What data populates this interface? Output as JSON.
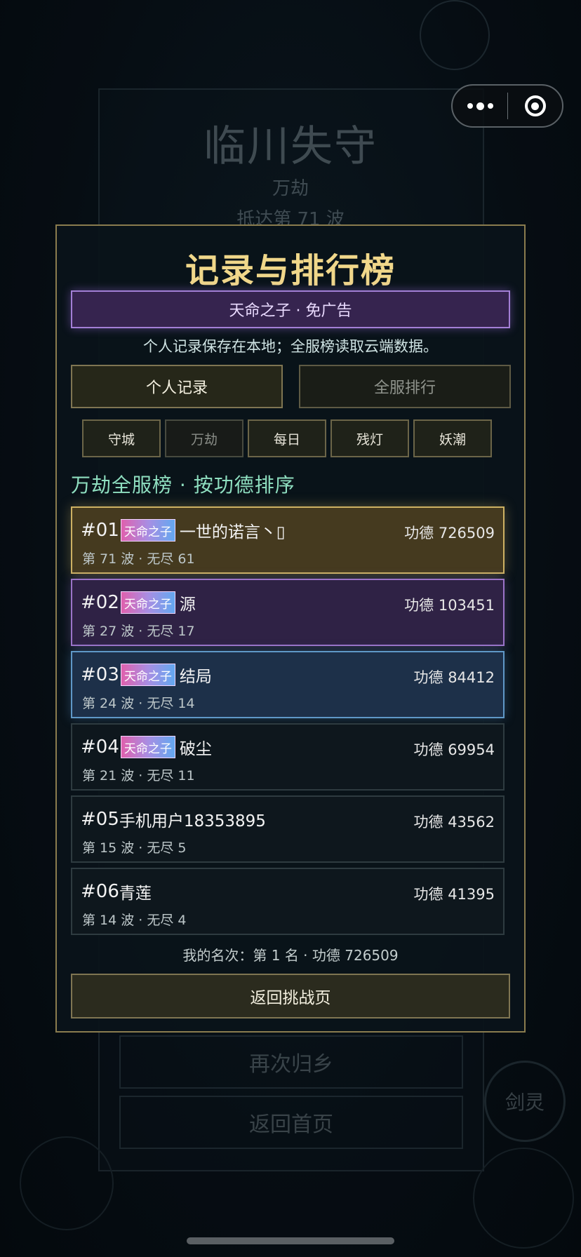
{
  "background_screen": {
    "title": "临川失守",
    "mode": "万劫",
    "wave": "抵达第 71 波",
    "buttons": [
      "再次归乡",
      "返回首页"
    ],
    "side_button": "剑灵"
  },
  "modal": {
    "title": "记录与排行榜",
    "vip_banner": "天命之子 · 免广告",
    "hint": "个人记录保存在本地；全服榜读取云端数据。",
    "main_tabs": [
      {
        "label": "个人记录",
        "active": true
      },
      {
        "label": "全服排行",
        "active": false
      }
    ],
    "mode_tabs": [
      {
        "label": "守城",
        "active": true
      },
      {
        "label": "万劫",
        "active": false
      },
      {
        "label": "每日",
        "active": true
      },
      {
        "label": "残灯",
        "active": true
      },
      {
        "label": "妖潮",
        "active": true
      }
    ],
    "section_title": "万劫全服榜 · 按功德排序",
    "rankings": [
      {
        "rank": "#01",
        "vip_tag": "天命之子",
        "name": "一世的诺言丶▯",
        "merit": "功德 726509",
        "detail": "第 71 波 · 无尽 61",
        "style": "gold"
      },
      {
        "rank": "#02",
        "vip_tag": "天命之子",
        "name": "源",
        "merit": "功德 103451",
        "detail": "第 27 波 · 无尽 17",
        "style": "purple"
      },
      {
        "rank": "#03",
        "vip_tag": "天命之子",
        "name": "结局",
        "merit": "功德 84412",
        "detail": "第 24 波 · 无尽 14",
        "style": "blue"
      },
      {
        "rank": "#04",
        "vip_tag": "天命之子",
        "name": "破尘",
        "merit": "功德 69954",
        "detail": "第 21 波 · 无尽 11",
        "style": "plain"
      },
      {
        "rank": "#05",
        "vip_tag": "",
        "name": "手机用户18353895",
        "merit": "功德 43562",
        "detail": "第 15 波 · 无尽 5",
        "style": "plain"
      },
      {
        "rank": "#06",
        "vip_tag": "",
        "name": "青莲",
        "merit": "功德 41395",
        "detail": "第 14 波 · 无尽 4",
        "style": "plain"
      }
    ],
    "my_rank": "我的名次：第 1 名 · 功德 726509",
    "return_button": "返回挑战页"
  },
  "capsule": {
    "more_icon": "more-dots-icon",
    "close_icon": "target-close-icon"
  },
  "colors": {
    "title_gold": "#f0d78a",
    "section_green": "#8fdfc0",
    "vip_purple": "#a37fd6",
    "rank1_gold": "#cdb163",
    "rank2_purple": "#9b73c8",
    "rank3_blue": "#5f98c7"
  }
}
